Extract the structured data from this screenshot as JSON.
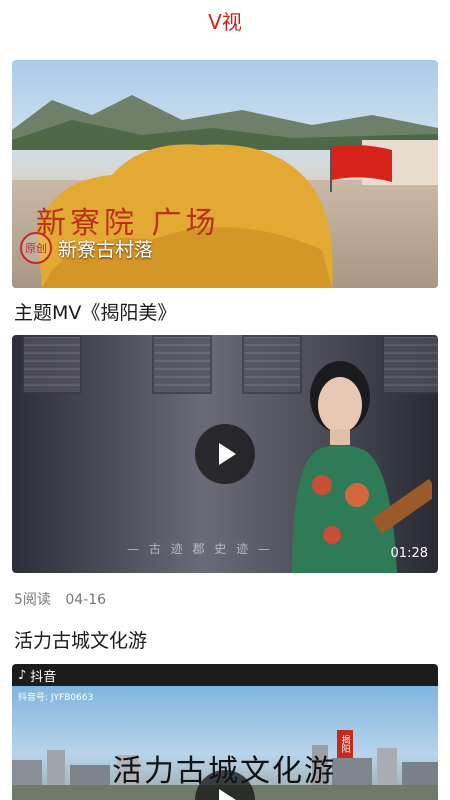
{
  "header": {
    "title": "V视"
  },
  "videos": [
    {
      "caption": "新寮古村落",
      "badge": "原创",
      "carved_text": "新寮院 广场"
    },
    {
      "title": "主题MV《揭阳美》",
      "duration": "01:28",
      "meta": {
        "reads": "5阅读",
        "date": "04-16"
      }
    },
    {
      "title": "活力古城文化游",
      "platform": "抖音",
      "douyin_id": "抖音号: JYFB0663",
      "overlay_title": "活力古城文化游",
      "stamp": "揭阳"
    }
  ],
  "icons": {
    "play": "play-icon",
    "tiktok": "tiktok-icon"
  },
  "colors": {
    "accent": "#d21e1e"
  }
}
